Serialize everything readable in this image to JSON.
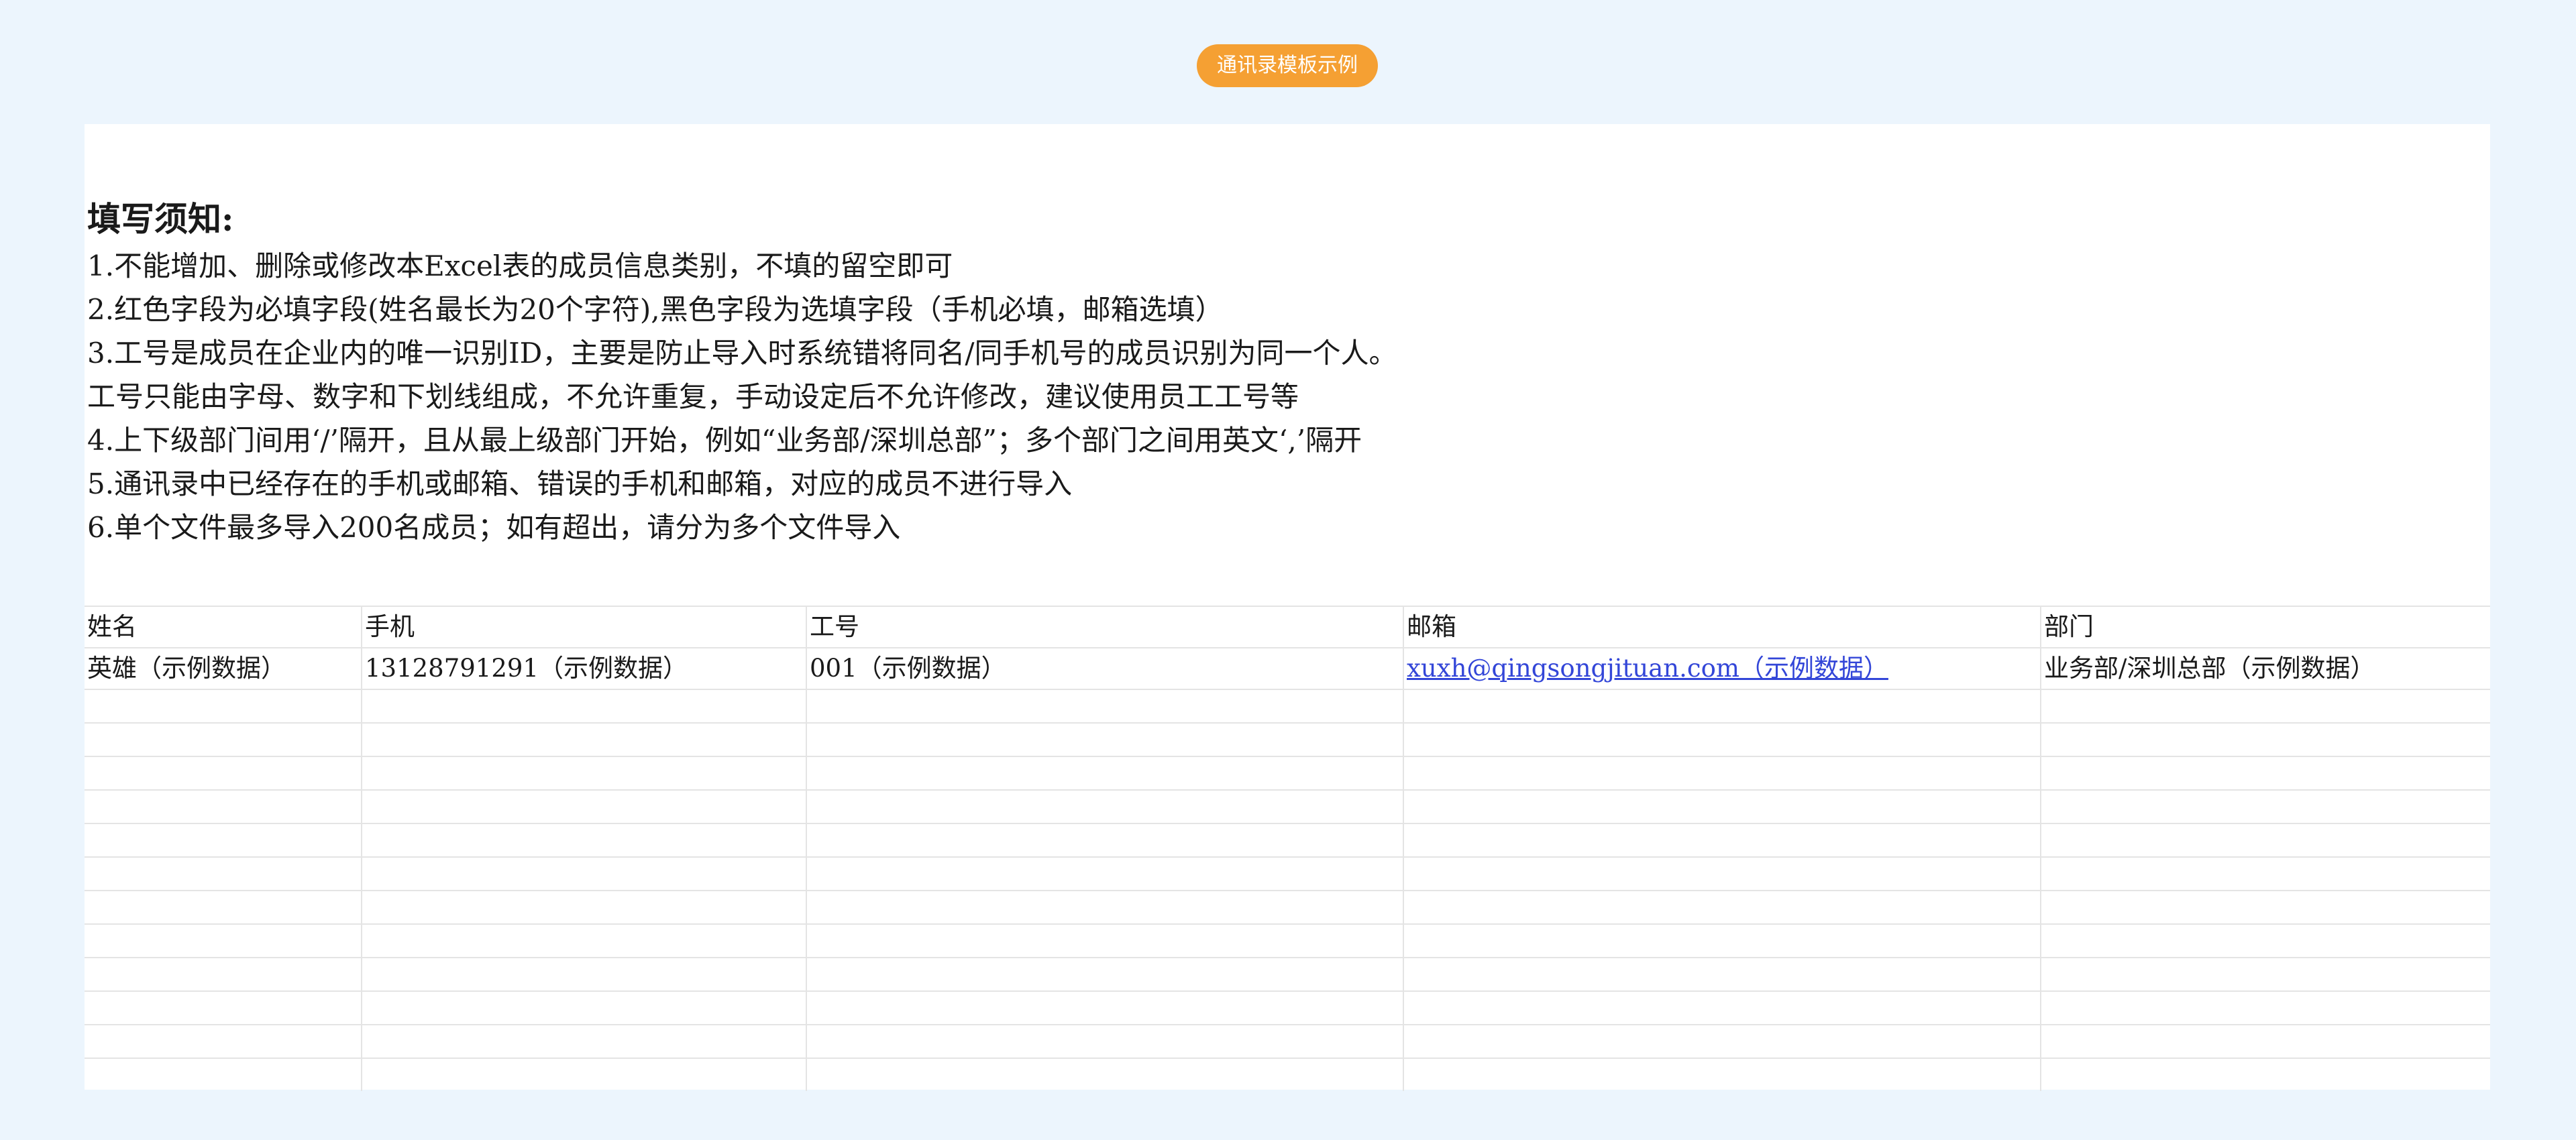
{
  "header": {
    "badge_label": "通讯录模板示例"
  },
  "notice": {
    "title": "填写须知:",
    "lines": [
      "1.不能增加、删除或修改本Excel表的成员信息类别，不填的留空即可",
      "2.红色字段为必填字段(姓名最长为20个字符),黑色字段为选填字段（手机必填，邮箱选填）",
      "3.工号是成员在企业内的唯一识别ID，主要是防止导入时系统错将同名/同手机号的成员识别为同一个人。",
      "   工号只能由字母、数字和下划线组成，不允许重复，手动设定后不允许修改，建议使用员工工号等",
      "4.上下级部门间用‘/’隔开，且从最上级部门开始，例如“业务部/深圳总部”；多个部门之间用英文‘,’隔开",
      "5.通讯录中已经存在的手机或邮箱、错误的手机和邮箱，对应的成员不进行导入",
      "6.单个文件最多导入200名成员；如有超出，请分为多个文件导入"
    ]
  },
  "table": {
    "columns": [
      {
        "label": "姓名",
        "required": true
      },
      {
        "label": "手机",
        "required": false
      },
      {
        "label": "工号",
        "required": true
      },
      {
        "label": "邮箱",
        "required": false
      },
      {
        "label": "部门",
        "required": false
      }
    ],
    "sample_row": {
      "name": "英雄（示例数据）",
      "phone": "13128791291（示例数据）",
      "employee_id": "001（示例数据）",
      "email": "xuxh@qingsongjituan.com（示例数据）",
      "department": "业务部/深圳总部（示例数据）"
    }
  },
  "colors": {
    "page_background": "#ecf5fd",
    "badge": "#f5a033",
    "required_field": "#ee2b2b",
    "link": "#3346d8",
    "grid_line": "#e4e4e4"
  }
}
